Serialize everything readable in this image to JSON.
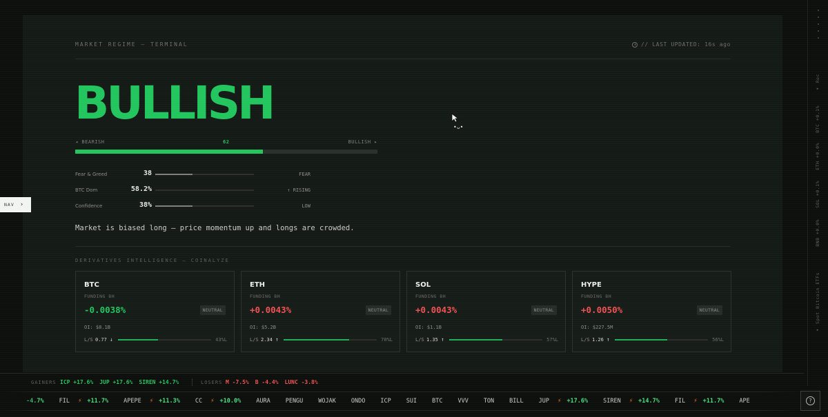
{
  "header": {
    "title": "MARKET REGIME — TERMINAL",
    "updated_label": "// LAST UPDATED: 16s ago"
  },
  "regime": {
    "label": "BULLISH",
    "gauge_left": "◂ BEARISH",
    "gauge_right": "BULLISH ▸",
    "gauge_value": "62",
    "gauge_fraction": 0.62
  },
  "metrics": [
    {
      "label": "Fear & Greed",
      "value": "38",
      "tag": "FEAR",
      "fraction": 0.38
    },
    {
      "label": "BTC Dom",
      "value": "58.2%",
      "tag": "↑ RISING",
      "fraction": 0.0
    },
    {
      "label": "Confidence",
      "value": "38%",
      "tag": "LOW",
      "fraction": 0.38
    }
  ],
  "summary": "Market is biased long — price momentum up and longs are crowded.",
  "derivatives": {
    "title": "DERIVATIVES INTELLIGENCE — COINALYZE",
    "funding_label": "FUNDING 8H",
    "ls_label": "L/S",
    "cards": [
      {
        "asset": "BTC",
        "rate": "-0.0038%",
        "status": "NEUTRAL",
        "oi": "OI: $8.1B",
        "ls": "0.77",
        "dir": "↓",
        "pct": "43%L",
        "long_fraction": 0.43,
        "tone": "neg"
      },
      {
        "asset": "ETH",
        "rate": "+0.0043%",
        "status": "NEUTRAL",
        "oi": "OI: $5.2B",
        "ls": "2.34",
        "dir": "↑",
        "pct": "70%L",
        "long_fraction": 0.7,
        "tone": "pos"
      },
      {
        "asset": "SOL",
        "rate": "+0.0043%",
        "status": "NEUTRAL",
        "oi": "OI: $1.1B",
        "ls": "1.35",
        "dir": "↑",
        "pct": "57%L",
        "long_fraction": 0.57,
        "tone": "pos"
      },
      {
        "asset": "HYPE",
        "rate": "+0.0050%",
        "status": "NEUTRAL",
        "oi": "OI: $227.5M",
        "ls": "1.26",
        "dir": "↑",
        "pct": "56%L",
        "long_fraction": 0.56,
        "tone": "pos"
      }
    ]
  },
  "movers": {
    "gainers_label": "GAINERS",
    "losers_label": "LOSERS",
    "gainers": [
      {
        "sym": "ICP",
        "chg": "+17.6%"
      },
      {
        "sym": "JUP",
        "chg": "+17.6%"
      },
      {
        "sym": "SIREN",
        "chg": "+14.7%"
      }
    ],
    "losers": [
      {
        "sym": "M",
        "chg": "-7.5%"
      },
      {
        "sym": "B",
        "chg": "-4.4%"
      },
      {
        "sym": "LUNC",
        "chg": "-3.8%"
      }
    ]
  },
  "ticker": [
    {
      "sym": "",
      "chg": "-4.7%",
      "bolt": false,
      "lead": true
    },
    {
      "sym": "FIL",
      "chg": "+11.7%",
      "bolt": true
    },
    {
      "sym": "APEPE",
      "chg": "+11.3%",
      "bolt": true
    },
    {
      "sym": "CC",
      "chg": "+10.0%",
      "bolt": true
    },
    {
      "sym": "AURA",
      "chg": "",
      "bolt": false
    },
    {
      "sym": "PENGU",
      "chg": "",
      "bolt": false
    },
    {
      "sym": "WOJAK",
      "chg": "",
      "bolt": false
    },
    {
      "sym": "ONDO",
      "chg": "",
      "bolt": false
    },
    {
      "sym": "ICP",
      "chg": "",
      "bolt": false
    },
    {
      "sym": "SUI",
      "chg": "",
      "bolt": false
    },
    {
      "sym": "BTC",
      "chg": "",
      "bolt": false
    },
    {
      "sym": "VVV",
      "chg": "",
      "bolt": false
    },
    {
      "sym": "TON",
      "chg": "",
      "bolt": false
    },
    {
      "sym": "BILL",
      "chg": "",
      "bolt": false
    },
    {
      "sym": "JUP",
      "chg": "+17.6%",
      "bolt": true
    },
    {
      "sym": "SIREN",
      "chg": "+14.7%",
      "bolt": true
    },
    {
      "sym": "FIL",
      "chg": "+11.7%",
      "bolt": true
    },
    {
      "sym": "APE",
      "chg": "",
      "bolt": false
    }
  ],
  "nav": {
    "label": "NAV",
    "chevron": "›"
  },
  "help": {
    "icon": "?"
  },
  "rail": {
    "items": [
      "◂ Spot Bitcoin ETFs",
      "BNB +0.0%",
      "SOL +0.1%",
      "ETH +0.0%",
      "BTC +0.1%",
      "◂ Rec"
    ]
  },
  "overlay": {
    "face": "•ᴗ•"
  },
  "colors": {
    "bull": "#22c55e",
    "bear": "#f05252",
    "bolt": "#f97316"
  }
}
